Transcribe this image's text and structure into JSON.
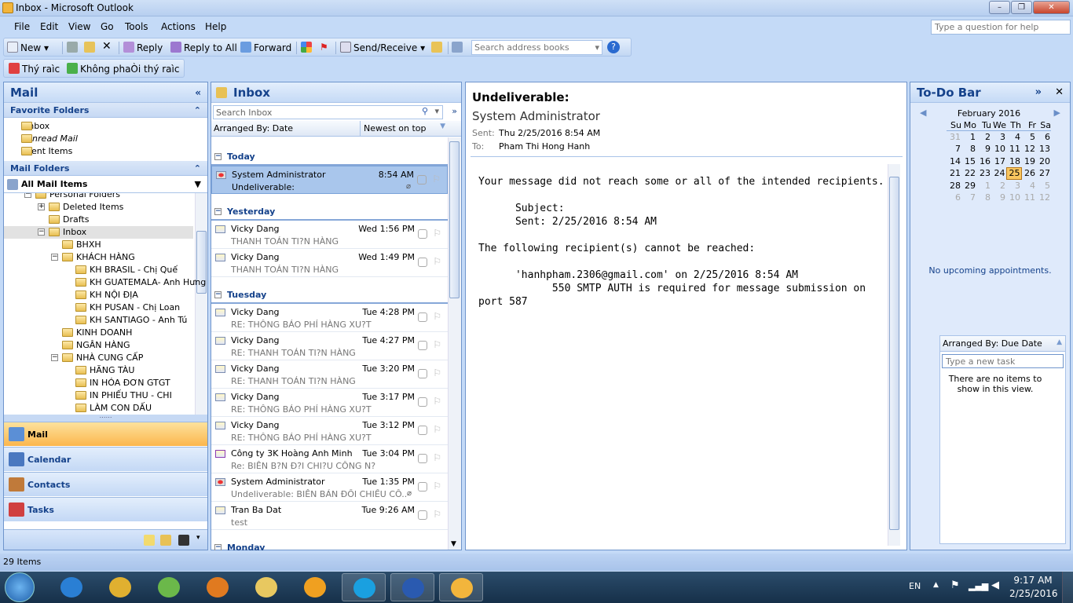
{
  "window": {
    "title": "Inbox - Microsoft Outlook",
    "min": "–",
    "max": "❐",
    "close": "✕"
  },
  "menu": [
    "File",
    "Edit",
    "View",
    "Go",
    "Tools",
    "Actions",
    "Help"
  ],
  "help_placeholder": "Type a question for help",
  "toolbar": {
    "new": "New",
    "reply": "Reply",
    "reply_all": "Reply to All",
    "forward": "Forward",
    "send_receive": "Send/Receive",
    "search_address": "Search address books"
  },
  "toolbar2": {
    "junk": "Thý raìc",
    "not_junk": "Không phaÒi thý raìc"
  },
  "nav": {
    "title": "Mail",
    "favorites_header": "Favorite Folders",
    "favorites": [
      "Inbox",
      "Unread Mail",
      "Sent Items"
    ],
    "mail_folders_header": "Mail Folders",
    "all_items": "All Mail Items",
    "folders": [
      {
        "label": "Personal Folders",
        "level": 0,
        "exp": "-"
      },
      {
        "label": "Deleted Items",
        "level": 1,
        "exp": "+"
      },
      {
        "label": "Drafts",
        "level": 1,
        "exp": ""
      },
      {
        "label": "Inbox",
        "level": 1,
        "exp": "-",
        "selected": true
      },
      {
        "label": "BHXH",
        "level": 2,
        "exp": ""
      },
      {
        "label": "KHÁCH HÀNG",
        "level": 2,
        "exp": "-"
      },
      {
        "label": "KH BRASIL - Chị Quế",
        "level": 3,
        "exp": ""
      },
      {
        "label": "KH GUATEMALA- Anh Hưng",
        "level": 3,
        "exp": ""
      },
      {
        "label": "KH NỘI ĐỊA",
        "level": 3,
        "exp": ""
      },
      {
        "label": "KH PUSAN - Chị Loan",
        "level": 3,
        "exp": ""
      },
      {
        "label": "KH SANTIAGO - Anh Tú",
        "level": 3,
        "exp": ""
      },
      {
        "label": "KINH DOANH",
        "level": 2,
        "exp": ""
      },
      {
        "label": "NGÂN HÀNG",
        "level": 2,
        "exp": ""
      },
      {
        "label": "NHÀ CUNG CẤP",
        "level": 2,
        "exp": "-"
      },
      {
        "label": "HÃNG TÀU",
        "level": 3,
        "exp": ""
      },
      {
        "label": "IN HÓA ĐƠN GTGT",
        "level": 3,
        "exp": ""
      },
      {
        "label": "IN PHIẾU THU - CHI",
        "level": 3,
        "exp": ""
      },
      {
        "label": "LÀM CON DẤU",
        "level": 3,
        "exp": ""
      }
    ],
    "buttons": [
      {
        "label": "Mail",
        "color": "#5b8fd6"
      },
      {
        "label": "Calendar",
        "color": "#4a78c0"
      },
      {
        "label": "Contacts",
        "color": "#c07a3a"
      },
      {
        "label": "Tasks",
        "color": "#d04040"
      }
    ]
  },
  "list": {
    "title": "Inbox",
    "search_placeholder": "Search Inbox",
    "arranged_by": "Arranged By: Date",
    "order": "Newest on top",
    "groups": [
      {
        "label": "Today",
        "items": [
          {
            "from": "System Administrator",
            "subject": "Undeliverable:",
            "time": "8:54 AM",
            "selected": true,
            "attach": true,
            "icon": "undeliverable"
          }
        ]
      },
      {
        "label": "Yesterday",
        "items": [
          {
            "from": "Vicky Dang",
            "subject": "THANH TOÁN TI?N HÀNG",
            "time": "Wed 1:56 PM"
          },
          {
            "from": "Vicky Dang",
            "subject": "THANH TOÁN TI?N HÀNG",
            "time": "Wed 1:49 PM"
          }
        ]
      },
      {
        "label": "Tuesday",
        "items": [
          {
            "from": "Vicky Dang",
            "subject": "RE: THÔNG BÁO PHÍ HÀNG XU?T",
            "time": "Tue 4:28 PM"
          },
          {
            "from": "Vicky Dang",
            "subject": "RE: THANH TOÁN TI?N HÀNG",
            "time": "Tue 4:27 PM"
          },
          {
            "from": "Vicky Dang",
            "subject": "RE: THANH TOÁN TI?N HÀNG",
            "time": "Tue 3:20 PM"
          },
          {
            "from": "Vicky Dang",
            "subject": "RE: THÔNG BÁO PHÍ HÀNG XU?T",
            "time": "Tue 3:17 PM"
          },
          {
            "from": "Vicky Dang",
            "subject": "RE: THÔNG BÁO PHÍ HÀNG XU?T",
            "time": "Tue 3:12 PM"
          },
          {
            "from": "Công ty 3K Hoàng Anh Minh",
            "subject": "Re: BIÊN B?N Đ?I CHI?U CÔNG N?",
            "time": "Tue 3:04 PM",
            "icon": "replied"
          },
          {
            "from": "System Administrator",
            "subject": "Undeliverable: BIÊN BẢN ĐỐI CHIẾU CÔ...",
            "time": "Tue 1:35 PM",
            "attach": true,
            "icon": "undeliverable"
          },
          {
            "from": "Tran Ba Dat",
            "subject": "test",
            "time": "Tue 9:26 AM"
          }
        ]
      },
      {
        "label": "Monday",
        "items": []
      }
    ]
  },
  "reading": {
    "subject": "Undeliverable:",
    "from": "System Administrator",
    "sent_label": "Sent:",
    "sent": "Thu 2/25/2016 8:54 AM",
    "to_label": "To:",
    "to": "Pham Thi Hong Hanh",
    "body": "Your message did not reach some or all of the intended recipients.\n\n      Subject:\n      Sent: 2/25/2016 8:54 AM\n\nThe following recipient(s) cannot be reached:\n\n      'hanhpham.2306@gmail.com' on 2/25/2016 8:54 AM\n            550 SMTP AUTH is required for message submission on\nport 587"
  },
  "todo": {
    "title": "To-Do Bar",
    "month": "February 2016",
    "weekdays": [
      "Su",
      "Mo",
      "Tu",
      "We",
      "Th",
      "Fr",
      "Sa"
    ],
    "weeks": [
      [
        "31",
        "1",
        "2",
        "3",
        "4",
        "5",
        "6"
      ],
      [
        "7",
        "8",
        "9",
        "10",
        "11",
        "12",
        "13"
      ],
      [
        "14",
        "15",
        "16",
        "17",
        "18",
        "19",
        "20"
      ],
      [
        "21",
        "22",
        "23",
        "24",
        "25",
        "26",
        "27"
      ],
      [
        "28",
        "29",
        "1",
        "2",
        "3",
        "4",
        "5"
      ],
      [
        "6",
        "7",
        "8",
        "9",
        "10",
        "11",
        "12"
      ]
    ],
    "today": "25",
    "no_appointments": "No upcoming appointments.",
    "tasks_arranged": "Arranged By: Due Date",
    "new_task_placeholder": "Type a new task",
    "no_items": "There are no items to show in this view."
  },
  "status": {
    "items": "29 Items"
  },
  "tray": {
    "lang": "EN",
    "time": "9:17 AM",
    "date": "2/25/2016"
  },
  "taskbar_apps": [
    {
      "name": "internet-explorer",
      "color": "#2a7fd4"
    },
    {
      "name": "chrome",
      "color": "#e0b030"
    },
    {
      "name": "coc-coc",
      "color": "#6bb84a"
    },
    {
      "name": "media-player",
      "color": "#e07a20"
    },
    {
      "name": "file-explorer",
      "color": "#e8c860"
    },
    {
      "name": "app-orange",
      "color": "#f0a020"
    },
    {
      "name": "skype",
      "color": "#1aa0e0"
    },
    {
      "name": "word",
      "color": "#2a5ab0"
    },
    {
      "name": "outlook",
      "color": "#f2b53c"
    }
  ]
}
